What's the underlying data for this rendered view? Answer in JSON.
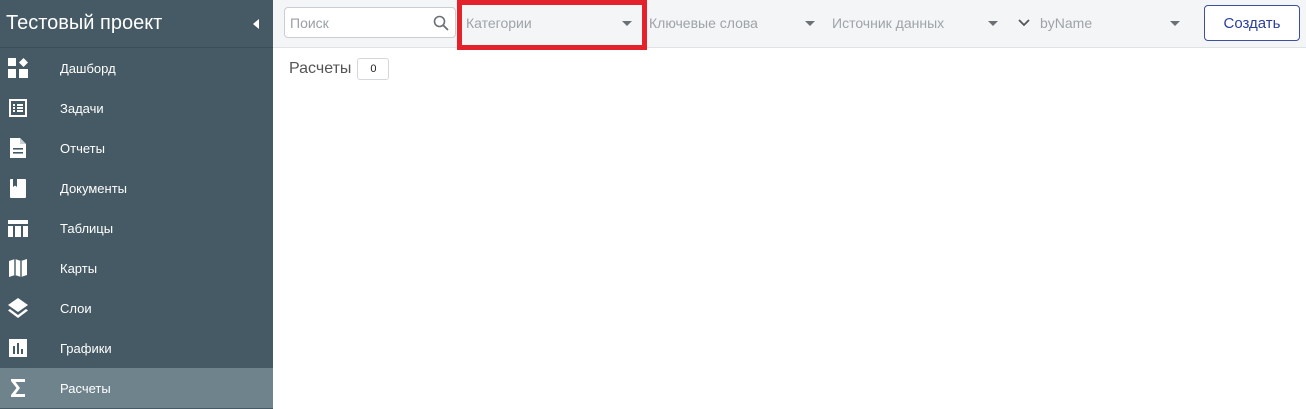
{
  "project": {
    "title": "Тестовый проект"
  },
  "sidebar": {
    "items": [
      {
        "label": "Дашборд",
        "icon": "dashboard-icon",
        "active": false
      },
      {
        "label": "Задачи",
        "icon": "tasks-icon",
        "active": false
      },
      {
        "label": "Отчеты",
        "icon": "report-icon",
        "active": false
      },
      {
        "label": "Документы",
        "icon": "documents-icon",
        "active": false
      },
      {
        "label": "Таблицы",
        "icon": "table-icon",
        "active": false
      },
      {
        "label": "Карты",
        "icon": "map-icon",
        "active": false
      },
      {
        "label": "Слои",
        "icon": "layers-icon",
        "active": false
      },
      {
        "label": "Графики",
        "icon": "bar-chart-icon",
        "active": false
      },
      {
        "label": "Расчеты",
        "icon": "sigma-icon",
        "active": true
      }
    ]
  },
  "toolbar": {
    "search_placeholder": "Поиск",
    "categories": "Категории",
    "keywords": "Ключевые слова",
    "data_source": "Источник данных",
    "sort": "byName",
    "create_label": "Создать"
  },
  "main": {
    "section_title": "Расчеты",
    "count": "0"
  },
  "colors": {
    "sidebar_bg": "#455a64",
    "active_item": "#6f838d",
    "accent": "#2b3f9b",
    "highlight": "#e3222b"
  }
}
